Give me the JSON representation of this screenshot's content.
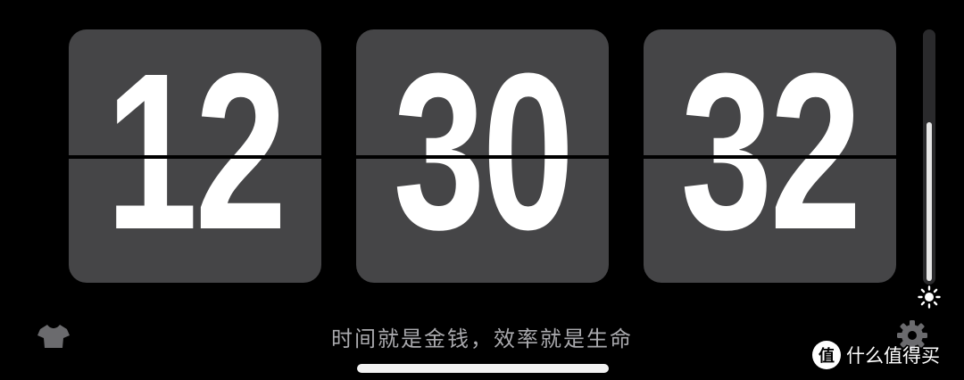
{
  "clock": {
    "hours": "12",
    "minutes": "30",
    "seconds": "32"
  },
  "brightness": {
    "level_percent": 64,
    "icon": "sun-icon"
  },
  "motto": "时间就是金钱，效率就是生命",
  "toolbar": {
    "theme_icon": "shirt-icon",
    "settings_icon": "gear-icon"
  },
  "watermark": {
    "logo_glyph": "值",
    "text": "什么值得买"
  },
  "colors": {
    "background": "#000000",
    "card": "#454547",
    "digit": "#ffffff",
    "motto": "#a9a9ad"
  }
}
